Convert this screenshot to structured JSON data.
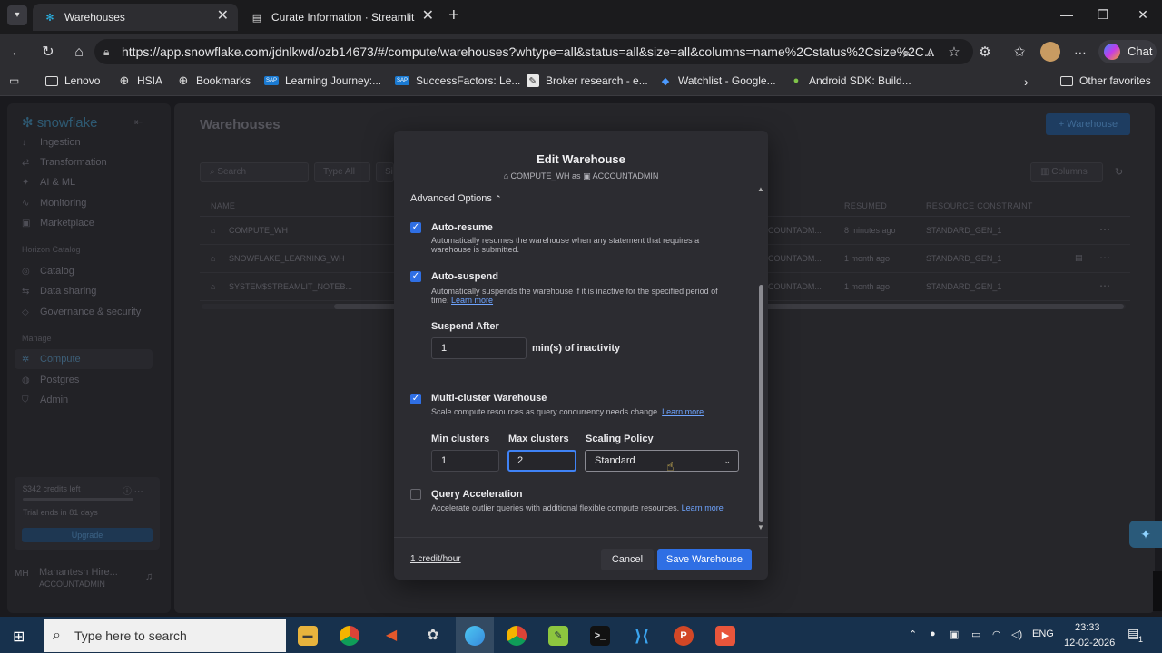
{
  "browser": {
    "tabs": [
      {
        "label": "Warehouses",
        "active": true
      },
      {
        "label": "Curate Information · Streamlit",
        "active": false
      }
    ],
    "url": "https://app.snowflake.com/jdnlkwd/ozb14673/#/compute/warehouses?whtype=all&status=all&size=all&columns=name%2Cstatus%2Csize%2C...",
    "chat_label": "Chat",
    "bookmarks": [
      "Lenovo",
      "HSIA",
      "Bookmarks",
      "Learning Journey:...",
      "SuccessFactors: Le...",
      "Broker research - e...",
      "Watchlist - Google...",
      "Android SDK: Build..."
    ],
    "other_favorites": "Other favorites"
  },
  "sidebar": {
    "brand": "snowflake",
    "items_top": [
      "Ingestion",
      "Transformation",
      "AI & ML",
      "Monitoring",
      "Marketplace"
    ],
    "horizon_heading": "Horizon Catalog",
    "items_horizon": [
      "Catalog",
      "Data sharing",
      "Governance & security"
    ],
    "manage_heading": "Manage",
    "items_manage": [
      "Compute",
      "Postgres",
      "Admin"
    ],
    "credits": "$342 credits left",
    "trial": "Trial ends in 81 days",
    "upgrade": "Upgrade",
    "user_initials": "MH",
    "user_name": "Mahantesh Hire...",
    "user_role": "ACCOUNTADMIN"
  },
  "main": {
    "title": "Warehouses",
    "add_button": "+ Warehouse",
    "search_placeholder": "Search",
    "type_filter": "Type  All",
    "columns_button": "Columns",
    "headers": {
      "name": "NAME",
      "resumed": "RESUMED",
      "constraint": "RESOURCE CONSTRAINT"
    },
    "rows": [
      {
        "name": "COMPUTE_WH",
        "owner": "COUNTADM...",
        "resumed": "8 minutes ago",
        "constraint": "STANDARD_GEN_1"
      },
      {
        "name": "SNOWFLAKE_LEARNING_WH",
        "owner": "COUNTADM...",
        "resumed": "1 month ago",
        "constraint": "STANDARD_GEN_1"
      },
      {
        "name": "SYSTEM$STREAMLIT_NOTEB...",
        "owner": "COUNTADM...",
        "resumed": "1 month ago",
        "constraint": "STANDARD_GEN_1"
      }
    ]
  },
  "modal": {
    "title": "Edit Warehouse",
    "warehouse": "COMPUTE_WH",
    "as_text": "as",
    "role": "ACCOUNTADMIN",
    "advanced_label": "Advanced Options",
    "auto_resume": {
      "title": "Auto-resume",
      "desc": "Automatically resumes the warehouse when any statement that requires a warehouse is submitted.",
      "checked": true
    },
    "auto_suspend": {
      "title": "Auto-suspend",
      "desc": "Automatically suspends the warehouse if it is inactive for the specified period of time.",
      "learn": "Learn more",
      "checked": true
    },
    "suspend_after_label": "Suspend After",
    "suspend_after_value": "1",
    "suspend_unit": "min(s) of inactivity",
    "multi_cluster": {
      "title": "Multi-cluster Warehouse",
      "desc": "Scale compute resources as query concurrency needs change.",
      "learn": "Learn more",
      "checked": true
    },
    "min_clusters_label": "Min clusters",
    "min_clusters_value": "1",
    "max_clusters_label": "Max clusters",
    "max_clusters_value": "2",
    "scaling_policy_label": "Scaling Policy",
    "scaling_policy_value": "Standard",
    "query_acceleration": {
      "title": "Query Acceleration",
      "desc": "Accelerate outlier queries with additional flexible compute resources.",
      "learn": "Learn more",
      "checked": false
    },
    "credit_rate": "1 credit/hour",
    "cancel": "Cancel",
    "save": "Save Warehouse"
  },
  "taskbar": {
    "search_placeholder": "Type here to search",
    "lang": "ENG",
    "time": "23:33",
    "date": "12-02-2026",
    "notifications": "1"
  },
  "colors": {
    "accent": "#2f6fe4",
    "link": "#6ea4ff",
    "taskbar": "#17314d"
  }
}
